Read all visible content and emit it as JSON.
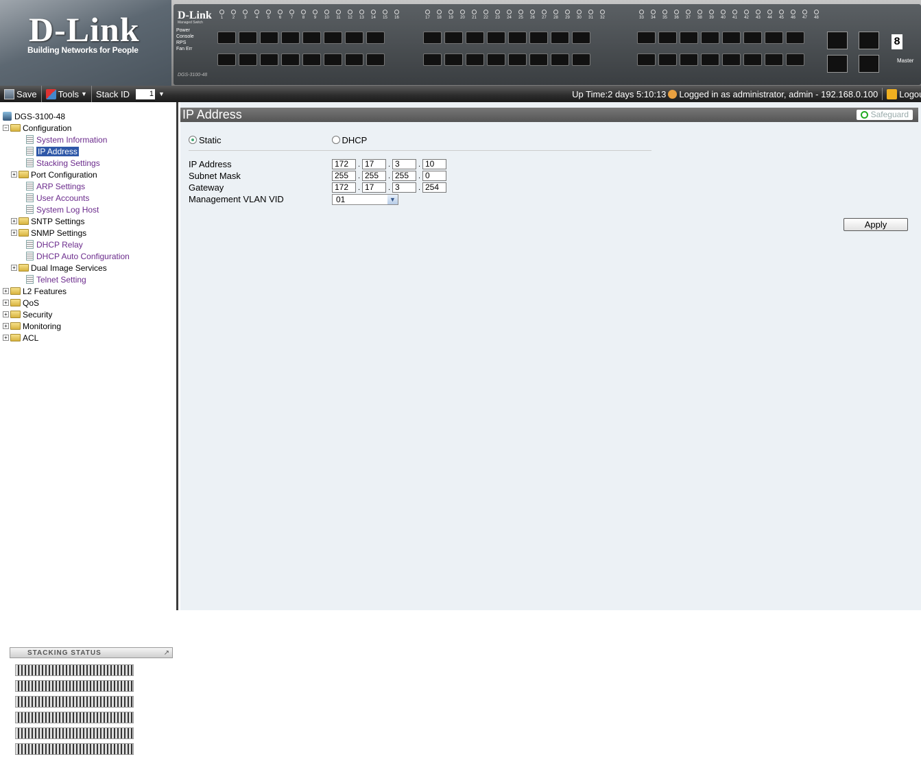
{
  "banner": {
    "logo_text": "D-Link",
    "logo_tagline": "Building Networks for People",
    "device_brand": "D-Link",
    "device_subtitle": "Managed Switch",
    "device_leds": [
      "Power",
      "Console",
      "RPS",
      "Fan Err"
    ],
    "device_model": "DGS-3100-48",
    "port_labels_a": [
      "1",
      "2",
      "3",
      "4",
      "5",
      "6",
      "7",
      "8",
      "9",
      "10",
      "11",
      "12",
      "13",
      "14",
      "15",
      "16"
    ],
    "port_labels_b": [
      "17",
      "18",
      "19",
      "20",
      "21",
      "22",
      "23",
      "24",
      "25",
      "26",
      "27",
      "28",
      "29",
      "30",
      "31",
      "32"
    ],
    "port_labels_c": [
      "33",
      "34",
      "35",
      "36",
      "37",
      "38",
      "39",
      "40",
      "41",
      "42",
      "43",
      "44",
      "45",
      "46",
      "47",
      "48"
    ],
    "sfp_labels": [
      "45",
      "46",
      "47",
      "48"
    ],
    "stack_digit": "8",
    "master_label": "Master"
  },
  "toolbar": {
    "save_label": "Save",
    "tools_label": "Tools",
    "stack_id_label": "Stack ID",
    "stack_id_value": "1",
    "uptime": "Up Time:2 days 5:10:13",
    "login_info": "Logged in as administrator, admin - 192.168.0.100",
    "logout_label": "Logout"
  },
  "sidebar": {
    "root": "DGS-3100-48",
    "configuration": "Configuration",
    "config_items": [
      {
        "label": "System Information",
        "type": "doc"
      },
      {
        "label": "IP Address",
        "type": "doc",
        "selected": true
      },
      {
        "label": "Stacking Settings",
        "type": "doc"
      },
      {
        "label": "Port Configuration",
        "type": "folder"
      },
      {
        "label": "ARP Settings",
        "type": "doc"
      },
      {
        "label": "User Accounts",
        "type": "doc"
      },
      {
        "label": "System Log Host",
        "type": "doc"
      },
      {
        "label": "SNTP Settings",
        "type": "folder"
      },
      {
        "label": "SNMP Settings",
        "type": "folder"
      },
      {
        "label": "DHCP Relay",
        "type": "doc"
      },
      {
        "label": "DHCP Auto Configuration",
        "type": "doc"
      },
      {
        "label": "Dual Image Services",
        "type": "folder"
      },
      {
        "label": "Telnet Setting",
        "type": "doc"
      }
    ],
    "top_items": [
      "L2 Features",
      "QoS",
      "Security",
      "Monitoring",
      "ACL"
    ],
    "stacking_status_title": "Stacking Status"
  },
  "main": {
    "title": "IP Address",
    "safeguard_label": "Safeguard",
    "mode_static": "Static",
    "mode_dhcp": "DHCP",
    "ip_label": "IP Address",
    "ip": [
      "172",
      "17",
      "3",
      "10"
    ],
    "mask_label": "Subnet Mask",
    "mask": [
      "255",
      "255",
      "255",
      "0"
    ],
    "gateway_label": "Gateway",
    "gateway": [
      "172",
      "17",
      "3",
      "254"
    ],
    "vlan_label": "Management VLAN VID",
    "vlan_value": "01",
    "apply_label": "Apply"
  },
  "colors": {
    "accent": "#2f58a8",
    "link": "#6b2b8c",
    "titlebar": "#666666"
  }
}
